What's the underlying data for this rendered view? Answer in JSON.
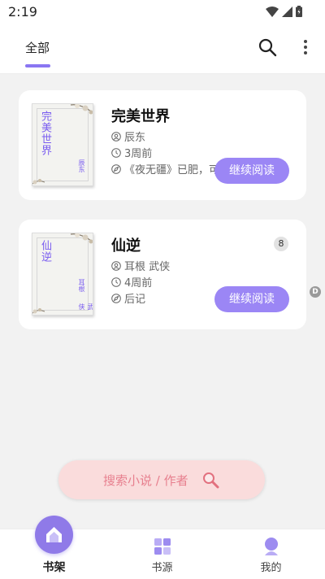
{
  "status_bar": {
    "time": "2:19"
  },
  "header": {
    "tab_all": "全部"
  },
  "books": [
    {
      "title": "完美世界",
      "cover_title": "完美世界",
      "cover_author": "辰东",
      "author": "辰东",
      "updated": "3周前",
      "latest": "《夜无疆》已肥，可以宰杀了",
      "continue_label": "继续阅读"
    },
    {
      "title": "仙逆",
      "cover_title": "仙逆",
      "cover_author_1": "耳根",
      "cover_author_2": "武侠",
      "author": "耳根 武侠",
      "updated": "4周前",
      "latest": "后记",
      "badge": "8",
      "continue_label": "继续阅读"
    }
  ],
  "float_button": {
    "label": "D"
  },
  "search_pill": {
    "label": "搜索小说 / 作者"
  },
  "bottom_nav": [
    {
      "label": "书架"
    },
    {
      "label": "书源"
    },
    {
      "label": "我的"
    }
  ],
  "colors": {
    "accent": "#8a76f2",
    "button": "#9b86f5",
    "search_pill_bg": "#fadcdc",
    "search_pill_text": "#e77f8e"
  }
}
